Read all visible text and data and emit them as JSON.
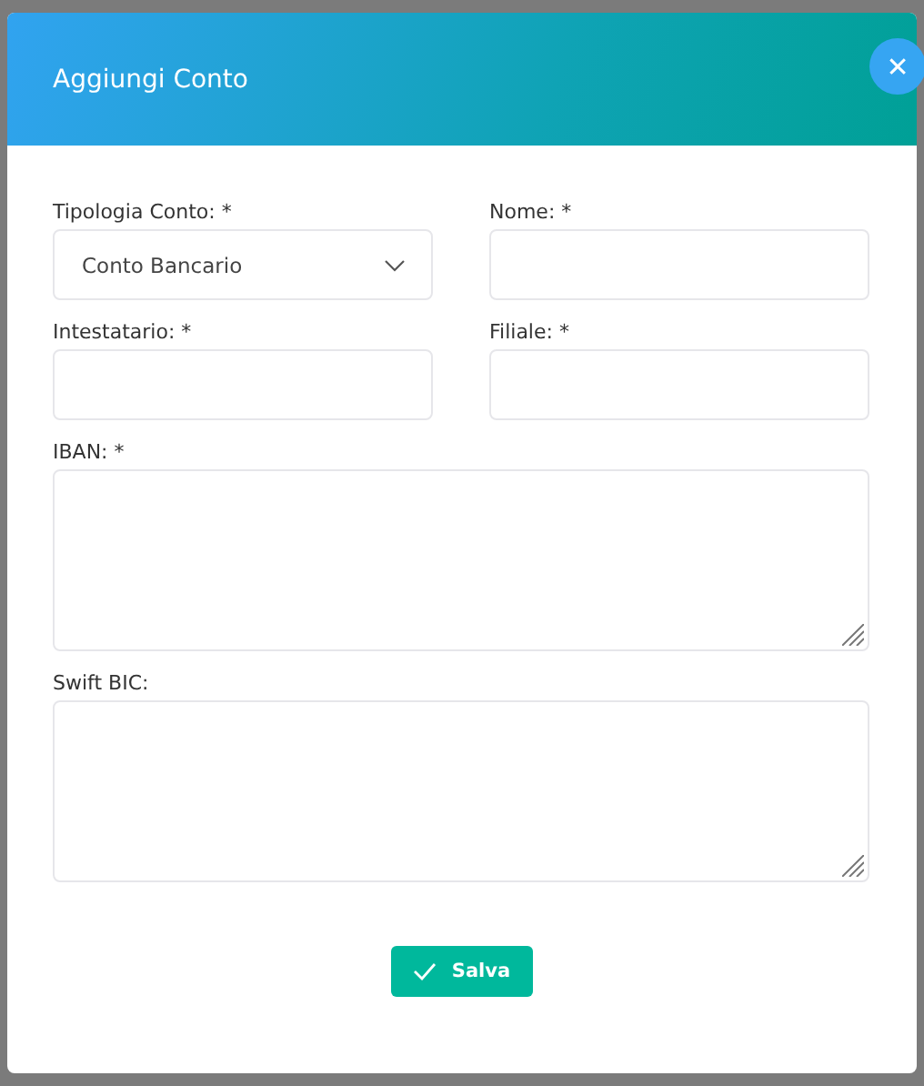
{
  "dialog": {
    "title": "Aggiungi Conto",
    "close": "✕"
  },
  "fields": [
    {
      "kind": "select",
      "label": "Tipologia Conto: *",
      "value": "Conto Bancario"
    },
    {
      "kind": "input",
      "label": "Nome: *"
    },
    {
      "kind": "input",
      "label": "Intestatario: *"
    },
    {
      "kind": "input",
      "label": "Filiale: *"
    },
    {
      "kind": "textarea",
      "label": "IBAN: *"
    },
    {
      "kind": "textarea",
      "label": "Swift BIC:"
    }
  ],
  "submit": {
    "label": "Salva"
  }
}
